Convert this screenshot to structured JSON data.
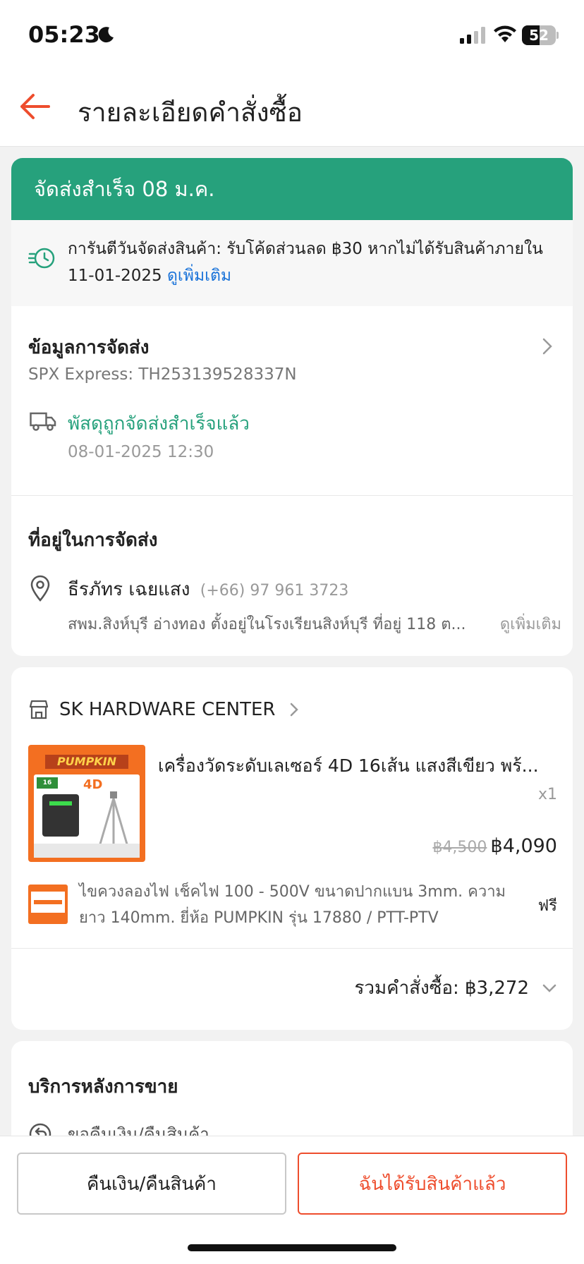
{
  "status_bar": {
    "time": "05:23",
    "battery": "52",
    "battery_level": 0.52
  },
  "header": {
    "title": "รายละเอียดคำสั่งซื้อ"
  },
  "shipping_status": {
    "banner": "จัดส่งสำเร็จ 08 ม.ค.",
    "guarantee_text": "การันตีวันจัดส่งสินค้า: รับโค้ดส่วนลด ฿30 หากไม่ได้รับสินค้าภายใน",
    "guarantee_date": "11-01-2025",
    "guarantee_link": "ดูเพิ่มเติม",
    "accent_color": "#26a17c"
  },
  "shipping_info": {
    "title": "ข้อมูลการจัดส่ง",
    "carrier": "SPX Express: TH253139528337N",
    "status": "พัสดุถูกจัดส่งสำเร็จแล้ว",
    "status_time": "08-01-2025 12:30"
  },
  "address": {
    "title": "ที่อยู่ในการจัดส่ง",
    "name": "ธีรภัทร เฉยแสง",
    "phone": "(+66) 97 961 3723",
    "line": "สพม.สิงห์บุรี อ่างทอง ตั้งอยู่ในโรงเรียนสิงห์บุรี ที่อยู่ 118 ต...",
    "more": "ดูเพิ่มเติม"
  },
  "shop": {
    "name": "SK HARDWARE CENTER",
    "product": {
      "name": "เครื่องวัดระดับเลเซอร์ 4D 16เส้น แสงสีเขียว พร้...",
      "qty": "x1",
      "old_price": "฿4,500",
      "price": "฿4,090",
      "image_brand": "PUMPKIN",
      "image_badge": "4D",
      "image_lines": "16 LINE"
    },
    "gift": {
      "name": "ไขควงลองไฟ เช็คไฟ 100 - 500V ขนาดปากแบน 3mm. ความยาว 140mm. ยี่ห้อ PUMPKIN รุ่น 17880 / PTT-PTV",
      "price": "ฟรี"
    },
    "total_label": "รวมคำสั่งซื้อ: ฿3,272"
  },
  "after_sales": {
    "title": "บริการหลังการขาย",
    "item": "ขอคืนเงิน/คืนสินค้า"
  },
  "actions": {
    "refund_button": "คืนเงิน/คืนสินค้า",
    "received_button": "ฉันได้รับสินค้าแล้ว",
    "brand_color": "#ee4d2d"
  }
}
